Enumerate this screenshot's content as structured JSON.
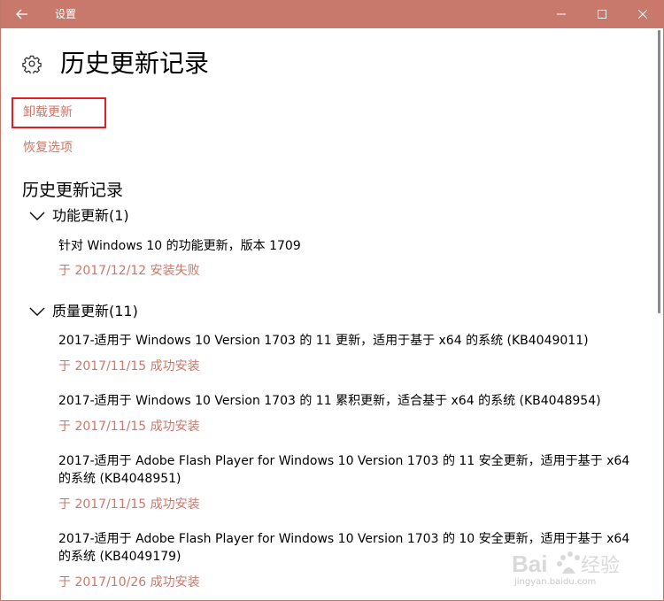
{
  "window": {
    "title": "设置",
    "controls": {
      "minimize": "minimize-icon",
      "maximize": "maximize-icon",
      "close": "close-icon"
    }
  },
  "page": {
    "title": "历史更新记录",
    "icon": "gear-icon",
    "uninstall_link": "卸载更新",
    "recovery_link": "恢复选项",
    "section_title": "历史更新记录"
  },
  "groups": [
    {
      "label": "功能更新(1)",
      "items": [
        {
          "title": "针对 Windows 10 的功能更新，版本 1709",
          "status": "于 2017/12/12 安装失败"
        }
      ]
    },
    {
      "label": "质量更新(11)",
      "items": [
        {
          "title": "2017-适用于 Windows 10 Version 1703 的 11 更新，适用于基于 x64 的系统 (KB4049011)",
          "status": "于 2017/11/15 成功安装"
        },
        {
          "title": "2017-适用于 Windows 10 Version 1703 的 11 累积更新，适合基于 x64 的系统 (KB4048954)",
          "status": "于 2017/11/15 成功安装"
        },
        {
          "title": "2017-适用于 Adobe Flash Player for Windows 10 Version 1703 的 11 安全更新，适用于基于 x64 的系统 (KB4048951)",
          "status": "于 2017/11/15 成功安装"
        },
        {
          "title": "2017-适用于 Adobe Flash Player for Windows 10 Version 1703 的 10 安全更新，适用于基于 x64 的系统 (KB4049179)",
          "status": "于 2017/10/26 成功安装"
        }
      ]
    }
  ],
  "watermark": {
    "text": "Baidu经验",
    "url_text": "jingyan.baidu.com"
  },
  "colors": {
    "accent": "#c8796b",
    "titlebar": "#c8796b",
    "highlight": "#e02020",
    "text": "#000000"
  }
}
